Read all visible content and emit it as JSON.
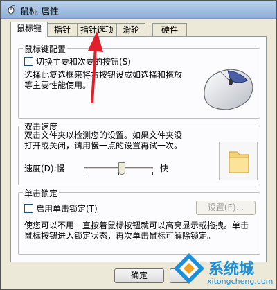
{
  "window": {
    "title": "鼠标 属性"
  },
  "tabs": [
    {
      "label": "鼠标键",
      "active": true
    },
    {
      "label": "指针",
      "active": false
    },
    {
      "label": "指针选项",
      "active": false
    },
    {
      "label": "滑轮",
      "active": false
    },
    {
      "label": "硬件",
      "active": false
    }
  ],
  "button_config": {
    "legend": "鼠标键配置",
    "swap_label": "切换主要和次要的按钮(S)",
    "swap_checked": false,
    "description_line1": "选择此复选框来将右按钮设成如选择和拖放",
    "description_line2": "等主要性能使用。"
  },
  "double_click": {
    "legend": "双击速度",
    "description_line1": "双击文件夹以检测您的设置。如果文件夹没",
    "description_line2": "打开或关闭，请用慢一点的设置再试一次。",
    "speed_label": "速度(D):慢",
    "fast_label": "快",
    "speed_value": 0.55
  },
  "click_lock": {
    "legend": "单击锁定",
    "enable_label": "启用单击锁定(T)",
    "enable_checked": false,
    "settings_button": "设置(E)...",
    "description_line1": "使您可以不用一直按着鼠标按钮就可以高亮显示或拖拽。单击",
    "description_line2": "鼠标按钮进入锁定状态，再次单击鼠标可解除锁定。"
  },
  "footer": {
    "ok_button": "确定"
  },
  "watermark": {
    "brand": "系统城",
    "site": "xitongcheng.com"
  },
  "colors": {
    "arrow": "#e0202a",
    "watermark_blue": "#1d8fd6",
    "watermark_orange": "#f0a020"
  }
}
